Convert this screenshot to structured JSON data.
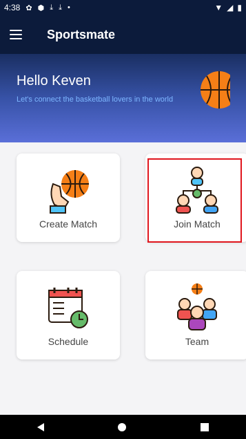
{
  "status_bar": {
    "time": "4:38",
    "notification_icons": [
      "gear-icon",
      "shield-icon",
      "download-icon",
      "download-icon",
      "dot-icon"
    ],
    "right_icons": [
      "wifi-icon",
      "signal-icon",
      "battery-icon"
    ]
  },
  "app_bar": {
    "title": "Sportsmate",
    "menu_icon": "menu-icon"
  },
  "hero": {
    "greeting": "Hello Keven",
    "subtitle": "Let's connect the basketball lovers in the world",
    "icon": "basketball-icon"
  },
  "cards": [
    {
      "label": "Create Match",
      "icon": "hand-basketball-icon"
    },
    {
      "label": "Join Match",
      "icon": "network-people-icon"
    },
    {
      "label": "Schedule",
      "icon": "calendar-clock-icon"
    },
    {
      "label": "Team",
      "icon": "team-icon"
    }
  ],
  "nav_bar": {
    "icons": [
      "back-icon",
      "home-icon",
      "recent-apps-icon"
    ]
  },
  "colors": {
    "header": "#0c1b3b",
    "highlight": "#e0151d",
    "subtitle": "#7eb7ff"
  }
}
